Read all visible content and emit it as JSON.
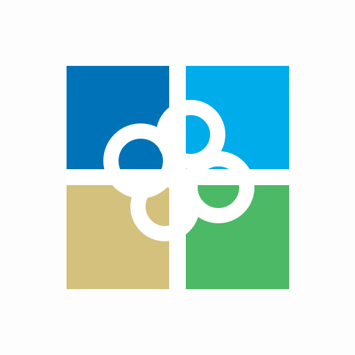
{
  "logo": {
    "icon": "puzzle-quadrant-logo-icon",
    "colors": {
      "background": "#fdfdfd",
      "top_left": "#0072b8",
      "top_right": "#00acea",
      "bottom_left": "#d4c17e",
      "bottom_right": "#4cb966",
      "knot": "#ffffff"
    }
  }
}
